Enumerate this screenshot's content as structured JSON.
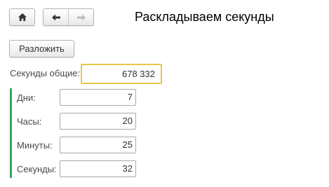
{
  "toolbar": {
    "home_icon": "home-icon",
    "back_icon": "arrow-left-icon",
    "forward_icon": "arrow-right-icon"
  },
  "form": {
    "title": "Раскладываем секунды",
    "split_button": "Разложить",
    "total_label": "Секунды общие:",
    "total_value": "678 332",
    "fields": [
      {
        "label": "Дни:",
        "value": "7"
      },
      {
        "label": "Часы:",
        "value": "20"
      },
      {
        "label": "Минуты:",
        "value": "25"
      },
      {
        "label": "Секунды:",
        "value": "32"
      }
    ]
  },
  "colors": {
    "accent_focus": "#e7c74b",
    "group_bar": "#3aa75a"
  }
}
